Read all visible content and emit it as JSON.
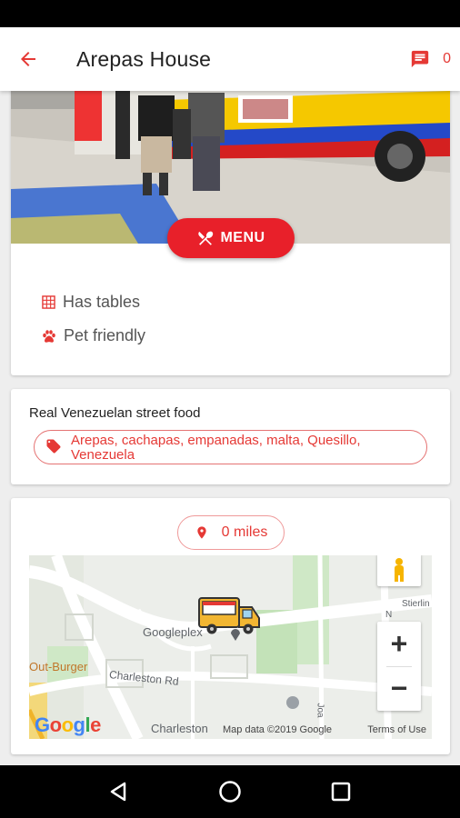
{
  "app_bar": {
    "title": "Arepas House",
    "message_count": "0",
    "colors": {
      "accent": "#e53935"
    }
  },
  "hero": {
    "menu_label": "MENU"
  },
  "features": [
    {
      "icon": "table-grid-icon",
      "label": "Has tables"
    },
    {
      "icon": "paw-icon",
      "label": "Pet friendly"
    }
  ],
  "description": {
    "text": "Real Venezuelan street food",
    "tags": "Arepas, cachapas, empanadas, malta, Quesillo, Venezuela"
  },
  "location": {
    "distance": "0 miles",
    "map": {
      "labels": {
        "googleplex": "Googleplex",
        "out_burger": "Out-Burger",
        "charleston_rd": "Charleston Rd",
        "charleston": "Charleston",
        "stierlin": "Stierlin",
        "joa": "Joa",
        "n": "N"
      },
      "attribution": "Map data ©2019 Google",
      "terms": "Terms of Use",
      "logo": "Google"
    }
  }
}
